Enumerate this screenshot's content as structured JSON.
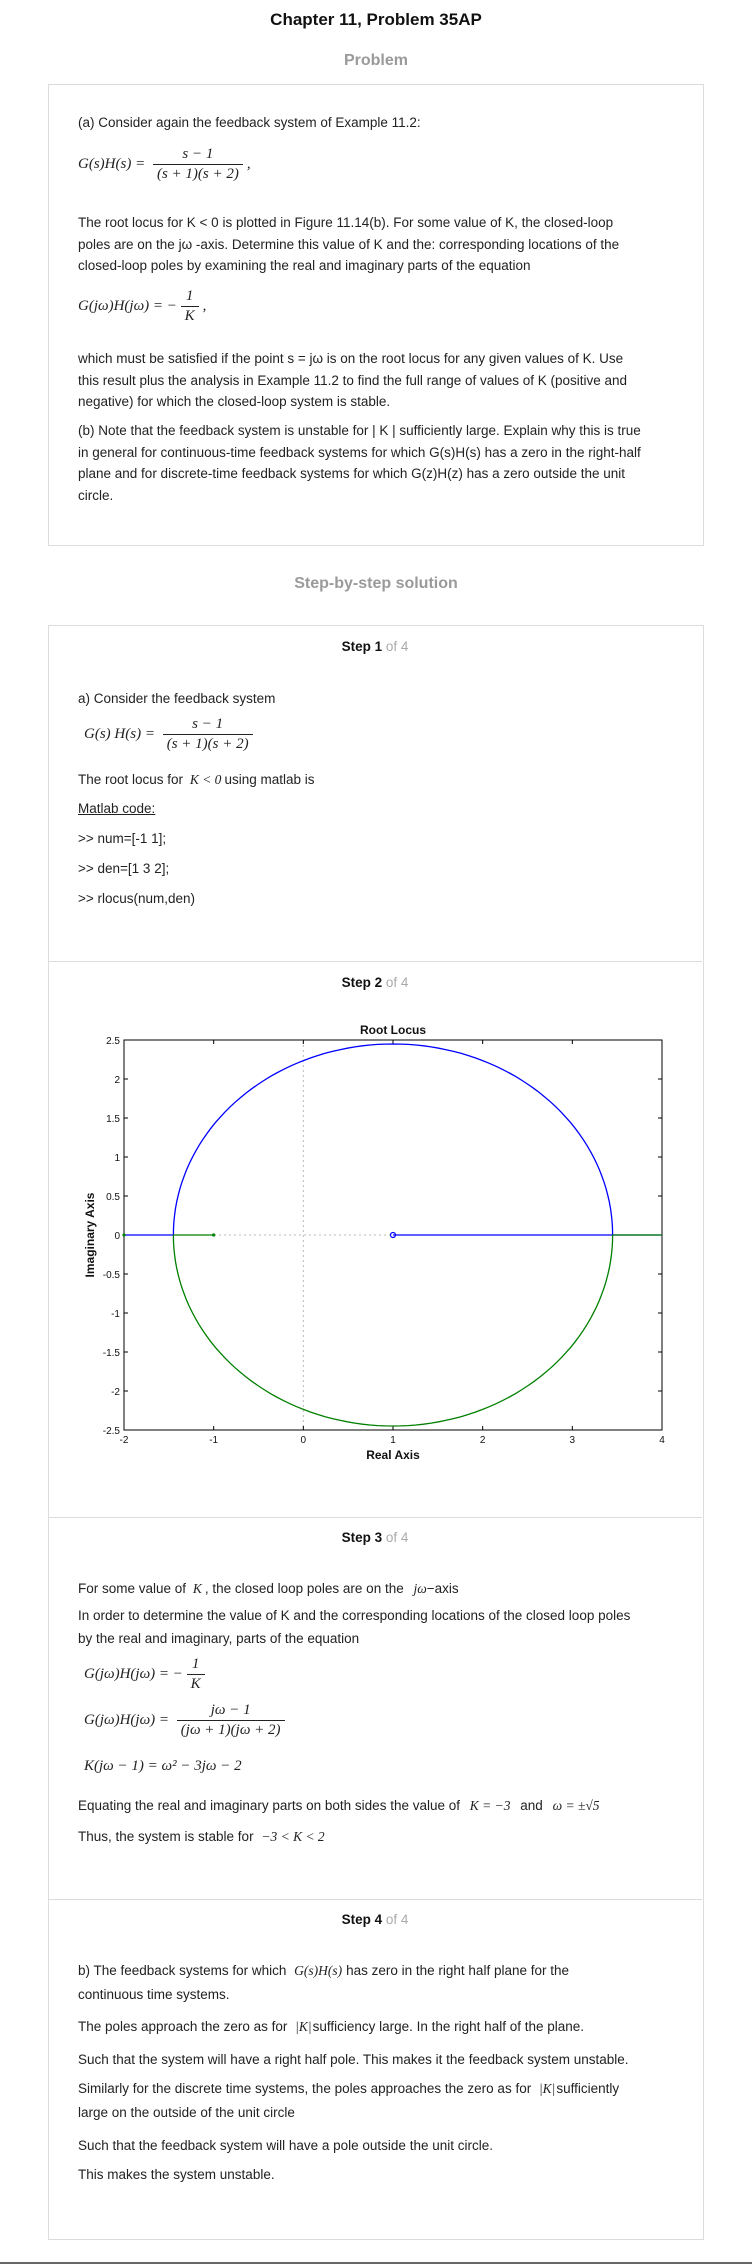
{
  "header": {
    "title": "Chapter 11, Problem 35AP"
  },
  "problem": {
    "heading": "Problem",
    "intro": "(a) Consider again the feedback system of Example 11.2:",
    "eq1_lhs": "G(s)H(s) =",
    "eq1_num": "s − 1",
    "eq1_den": "(s + 1)(s + 2)",
    "eq1_tail": ",",
    "para1_l1": "The root locus for K < 0 is plotted in Figure 11.14(b). For some value of K, the closed-loop",
    "para1_l2": "poles are on the jω -axis. Determine this value of K and the: corresponding locations of the",
    "para1_l3": "closed-loop poles by examining the real and imaginary parts of the equation",
    "eq2_lhs": "G(jω)H(jω) = −",
    "eq2_num": "1",
    "eq2_den": "K",
    "eq2_tail": ",",
    "para2_l1": "which must be satisfied if the point s = jω is on the root locus for any given values of K. Use",
    "para2_l2": "this result plus the analysis in Example 11.2 to find the full range of values of K (positive and",
    "para2_l3": "negative) for which the closed-loop system is stable.",
    "para3_l1": "(b) Note that the feedback system is unstable for | K | sufficiently large. Explain why this is true",
    "para3_l2": "in general for continuous-time feedback systems for which G(s)H(s) has a zero in the right-half",
    "para3_l3": "plane and for discrete-time feedback systems for which G(z)H(z) has a zero outside the unit",
    "para3_l4": "circle."
  },
  "solution": {
    "heading": "Step-by-step solution",
    "step_word": "Step",
    "of_text": "of 4",
    "steps": [
      {
        "num": "1"
      },
      {
        "num": "2"
      },
      {
        "num": "3"
      },
      {
        "num": "4"
      }
    ],
    "step1": {
      "l1": "a) Consider the feedback system",
      "eq_lhs": "G(s) H(s) =",
      "eq_num": "s − 1",
      "eq_den": "(s + 1)(s + 2)",
      "l2_pre": "The root locus for",
      "l2_math": "K < 0",
      "l2_post": "using matlab is",
      "matlab_label": "Matlab code:",
      "code1": ">> num=[-1 1];",
      "code2": ">> den=[1 3 2];",
      "code3": ">> rlocus(num,den)"
    },
    "step3": {
      "l1_pre": "For some value of",
      "l1_m1": "K",
      "l1_mid": ", the closed loop poles are on the",
      "l1_m2": "jω",
      "l1_post": "−axis",
      "l2": "In order to determine the value of K and the corresponding locations of the closed loop poles",
      "l3": "by the real and imaginary, parts of the equation",
      "eqA_lhs": "G(jω)H(jω) = −",
      "eqA_num": "1",
      "eqA_den": "K",
      "eqB_lhs": "G(jω)H(jω) =",
      "eqB_num": "jω − 1",
      "eqB_den": "(jω + 1)(jω + 2)",
      "eqC": "K(jω − 1) = ω² − 3jω − 2",
      "l4_pre": "Equating the real and imaginary parts on both sides the value of",
      "l4_m1": "K = −3",
      "l4_and": "and",
      "l4_m2": "ω = ±√5",
      "l5_pre": "Thus, the system is stable for",
      "l5_m": "−3 < K < 2"
    },
    "step4": {
      "l1_pre": "b) The feedback systems for which",
      "l1_m": "G(s)H(s)",
      "l1_post": "has zero in the right half plane for the",
      "l2": "continuous time systems.",
      "l3_pre": "The poles approach the zero as for",
      "l3_m": "|K|",
      "l3_post": "sufficiency large. In the right half of the plane.",
      "l4": "Such that the system will have a right half pole. This makes it the feedback system unstable.",
      "l5_pre": "Similarly for the discrete time systems, the poles approaches the zero as for",
      "l5_m": "|K|",
      "l5_post": "sufficiently",
      "l6": "large on the outside of the unit circle",
      "l7": "Such that the feedback system will have a pole outside the unit circle.",
      "l8": "This makes the system unstable."
    }
  },
  "chart_data": {
    "type": "line",
    "title": "Root Locus",
    "xlabel": "Real Axis",
    "ylabel": "Imaginary Axis",
    "xlim": [
      -2,
      4
    ],
    "ylim": [
      -2.5,
      2.5
    ],
    "xticks": [
      "-2",
      "-1",
      "0",
      "1",
      "2",
      "3",
      "4"
    ],
    "yticks": [
      "2.5",
      "2",
      "1.5",
      "1",
      "0.5",
      "0",
      "-0.5",
      "-1",
      "-1.5",
      "-2",
      "-2.5"
    ],
    "circle_center": [
      1,
      0
    ],
    "circle_radius": 2.449,
    "poles": [
      [
        -1,
        0
      ],
      [
        -2,
        0
      ]
    ],
    "zeros": [
      [
        1,
        0
      ]
    ],
    "colors": {
      "upper": "#0000ff",
      "lower": "#008000"
    },
    "series": [
      {
        "color": "#0000ff",
        "segments": [
          {
            "x": [
              -2,
              -1.449
            ],
            "y": [
              0,
              0
            ]
          },
          {
            "x": [
              1,
              3.449,
              4
            ],
            "y": [
              0,
              0,
              0
            ]
          },
          {
            "arc": "upper"
          }
        ]
      },
      {
        "color": "#008000",
        "segments": [
          {
            "x": [
              -1,
              -1.449
            ],
            "y": [
              0,
              0
            ]
          },
          {
            "x": [
              3.449,
              4
            ],
            "y": [
              0,
              0
            ]
          },
          {
            "arc": "lower"
          }
        ]
      }
    ]
  }
}
